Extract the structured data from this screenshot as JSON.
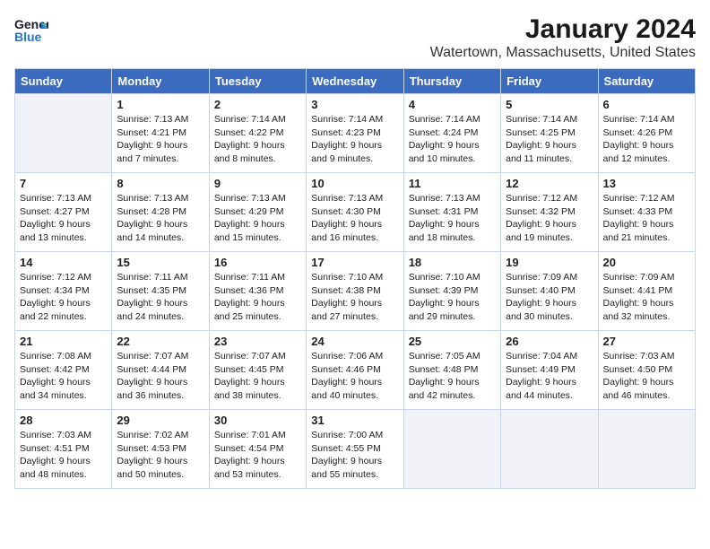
{
  "app": {
    "logo_general": "General",
    "logo_blue": "Blue",
    "title": "January 2024",
    "subtitle": "Watertown, Massachusetts, United States"
  },
  "calendar": {
    "headers": [
      "Sunday",
      "Monday",
      "Tuesday",
      "Wednesday",
      "Thursday",
      "Friday",
      "Saturday"
    ],
    "weeks": [
      [
        {
          "day": "",
          "empty": true
        },
        {
          "day": "1",
          "sunrise": "Sunrise: 7:13 AM",
          "sunset": "Sunset: 4:21 PM",
          "daylight": "Daylight: 9 hours and 7 minutes."
        },
        {
          "day": "2",
          "sunrise": "Sunrise: 7:14 AM",
          "sunset": "Sunset: 4:22 PM",
          "daylight": "Daylight: 9 hours and 8 minutes."
        },
        {
          "day": "3",
          "sunrise": "Sunrise: 7:14 AM",
          "sunset": "Sunset: 4:23 PM",
          "daylight": "Daylight: 9 hours and 9 minutes."
        },
        {
          "day": "4",
          "sunrise": "Sunrise: 7:14 AM",
          "sunset": "Sunset: 4:24 PM",
          "daylight": "Daylight: 9 hours and 10 minutes."
        },
        {
          "day": "5",
          "sunrise": "Sunrise: 7:14 AM",
          "sunset": "Sunset: 4:25 PM",
          "daylight": "Daylight: 9 hours and 11 minutes."
        },
        {
          "day": "6",
          "sunrise": "Sunrise: 7:14 AM",
          "sunset": "Sunset: 4:26 PM",
          "daylight": "Daylight: 9 hours and 12 minutes."
        }
      ],
      [
        {
          "day": "7",
          "sunrise": "Sunrise: 7:13 AM",
          "sunset": "Sunset: 4:27 PM",
          "daylight": "Daylight: 9 hours and 13 minutes."
        },
        {
          "day": "8",
          "sunrise": "Sunrise: 7:13 AM",
          "sunset": "Sunset: 4:28 PM",
          "daylight": "Daylight: 9 hours and 14 minutes."
        },
        {
          "day": "9",
          "sunrise": "Sunrise: 7:13 AM",
          "sunset": "Sunset: 4:29 PM",
          "daylight": "Daylight: 9 hours and 15 minutes."
        },
        {
          "day": "10",
          "sunrise": "Sunrise: 7:13 AM",
          "sunset": "Sunset: 4:30 PM",
          "daylight": "Daylight: 9 hours and 16 minutes."
        },
        {
          "day": "11",
          "sunrise": "Sunrise: 7:13 AM",
          "sunset": "Sunset: 4:31 PM",
          "daylight": "Daylight: 9 hours and 18 minutes."
        },
        {
          "day": "12",
          "sunrise": "Sunrise: 7:12 AM",
          "sunset": "Sunset: 4:32 PM",
          "daylight": "Daylight: 9 hours and 19 minutes."
        },
        {
          "day": "13",
          "sunrise": "Sunrise: 7:12 AM",
          "sunset": "Sunset: 4:33 PM",
          "daylight": "Daylight: 9 hours and 21 minutes."
        }
      ],
      [
        {
          "day": "14",
          "sunrise": "Sunrise: 7:12 AM",
          "sunset": "Sunset: 4:34 PM",
          "daylight": "Daylight: 9 hours and 22 minutes."
        },
        {
          "day": "15",
          "sunrise": "Sunrise: 7:11 AM",
          "sunset": "Sunset: 4:35 PM",
          "daylight": "Daylight: 9 hours and 24 minutes."
        },
        {
          "day": "16",
          "sunrise": "Sunrise: 7:11 AM",
          "sunset": "Sunset: 4:36 PM",
          "daylight": "Daylight: 9 hours and 25 minutes."
        },
        {
          "day": "17",
          "sunrise": "Sunrise: 7:10 AM",
          "sunset": "Sunset: 4:38 PM",
          "daylight": "Daylight: 9 hours and 27 minutes."
        },
        {
          "day": "18",
          "sunrise": "Sunrise: 7:10 AM",
          "sunset": "Sunset: 4:39 PM",
          "daylight": "Daylight: 9 hours and 29 minutes."
        },
        {
          "day": "19",
          "sunrise": "Sunrise: 7:09 AM",
          "sunset": "Sunset: 4:40 PM",
          "daylight": "Daylight: 9 hours and 30 minutes."
        },
        {
          "day": "20",
          "sunrise": "Sunrise: 7:09 AM",
          "sunset": "Sunset: 4:41 PM",
          "daylight": "Daylight: 9 hours and 32 minutes."
        }
      ],
      [
        {
          "day": "21",
          "sunrise": "Sunrise: 7:08 AM",
          "sunset": "Sunset: 4:42 PM",
          "daylight": "Daylight: 9 hours and 34 minutes."
        },
        {
          "day": "22",
          "sunrise": "Sunrise: 7:07 AM",
          "sunset": "Sunset: 4:44 PM",
          "daylight": "Daylight: 9 hours and 36 minutes."
        },
        {
          "day": "23",
          "sunrise": "Sunrise: 7:07 AM",
          "sunset": "Sunset: 4:45 PM",
          "daylight": "Daylight: 9 hours and 38 minutes."
        },
        {
          "day": "24",
          "sunrise": "Sunrise: 7:06 AM",
          "sunset": "Sunset: 4:46 PM",
          "daylight": "Daylight: 9 hours and 40 minutes."
        },
        {
          "day": "25",
          "sunrise": "Sunrise: 7:05 AM",
          "sunset": "Sunset: 4:48 PM",
          "daylight": "Daylight: 9 hours and 42 minutes."
        },
        {
          "day": "26",
          "sunrise": "Sunrise: 7:04 AM",
          "sunset": "Sunset: 4:49 PM",
          "daylight": "Daylight: 9 hours and 44 minutes."
        },
        {
          "day": "27",
          "sunrise": "Sunrise: 7:03 AM",
          "sunset": "Sunset: 4:50 PM",
          "daylight": "Daylight: 9 hours and 46 minutes."
        }
      ],
      [
        {
          "day": "28",
          "sunrise": "Sunrise: 7:03 AM",
          "sunset": "Sunset: 4:51 PM",
          "daylight": "Daylight: 9 hours and 48 minutes."
        },
        {
          "day": "29",
          "sunrise": "Sunrise: 7:02 AM",
          "sunset": "Sunset: 4:53 PM",
          "daylight": "Daylight: 9 hours and 50 minutes."
        },
        {
          "day": "30",
          "sunrise": "Sunrise: 7:01 AM",
          "sunset": "Sunset: 4:54 PM",
          "daylight": "Daylight: 9 hours and 53 minutes."
        },
        {
          "day": "31",
          "sunrise": "Sunrise: 7:00 AM",
          "sunset": "Sunset: 4:55 PM",
          "daylight": "Daylight: 9 hours and 55 minutes."
        },
        {
          "day": "",
          "empty": true
        },
        {
          "day": "",
          "empty": true
        },
        {
          "day": "",
          "empty": true
        }
      ]
    ]
  }
}
